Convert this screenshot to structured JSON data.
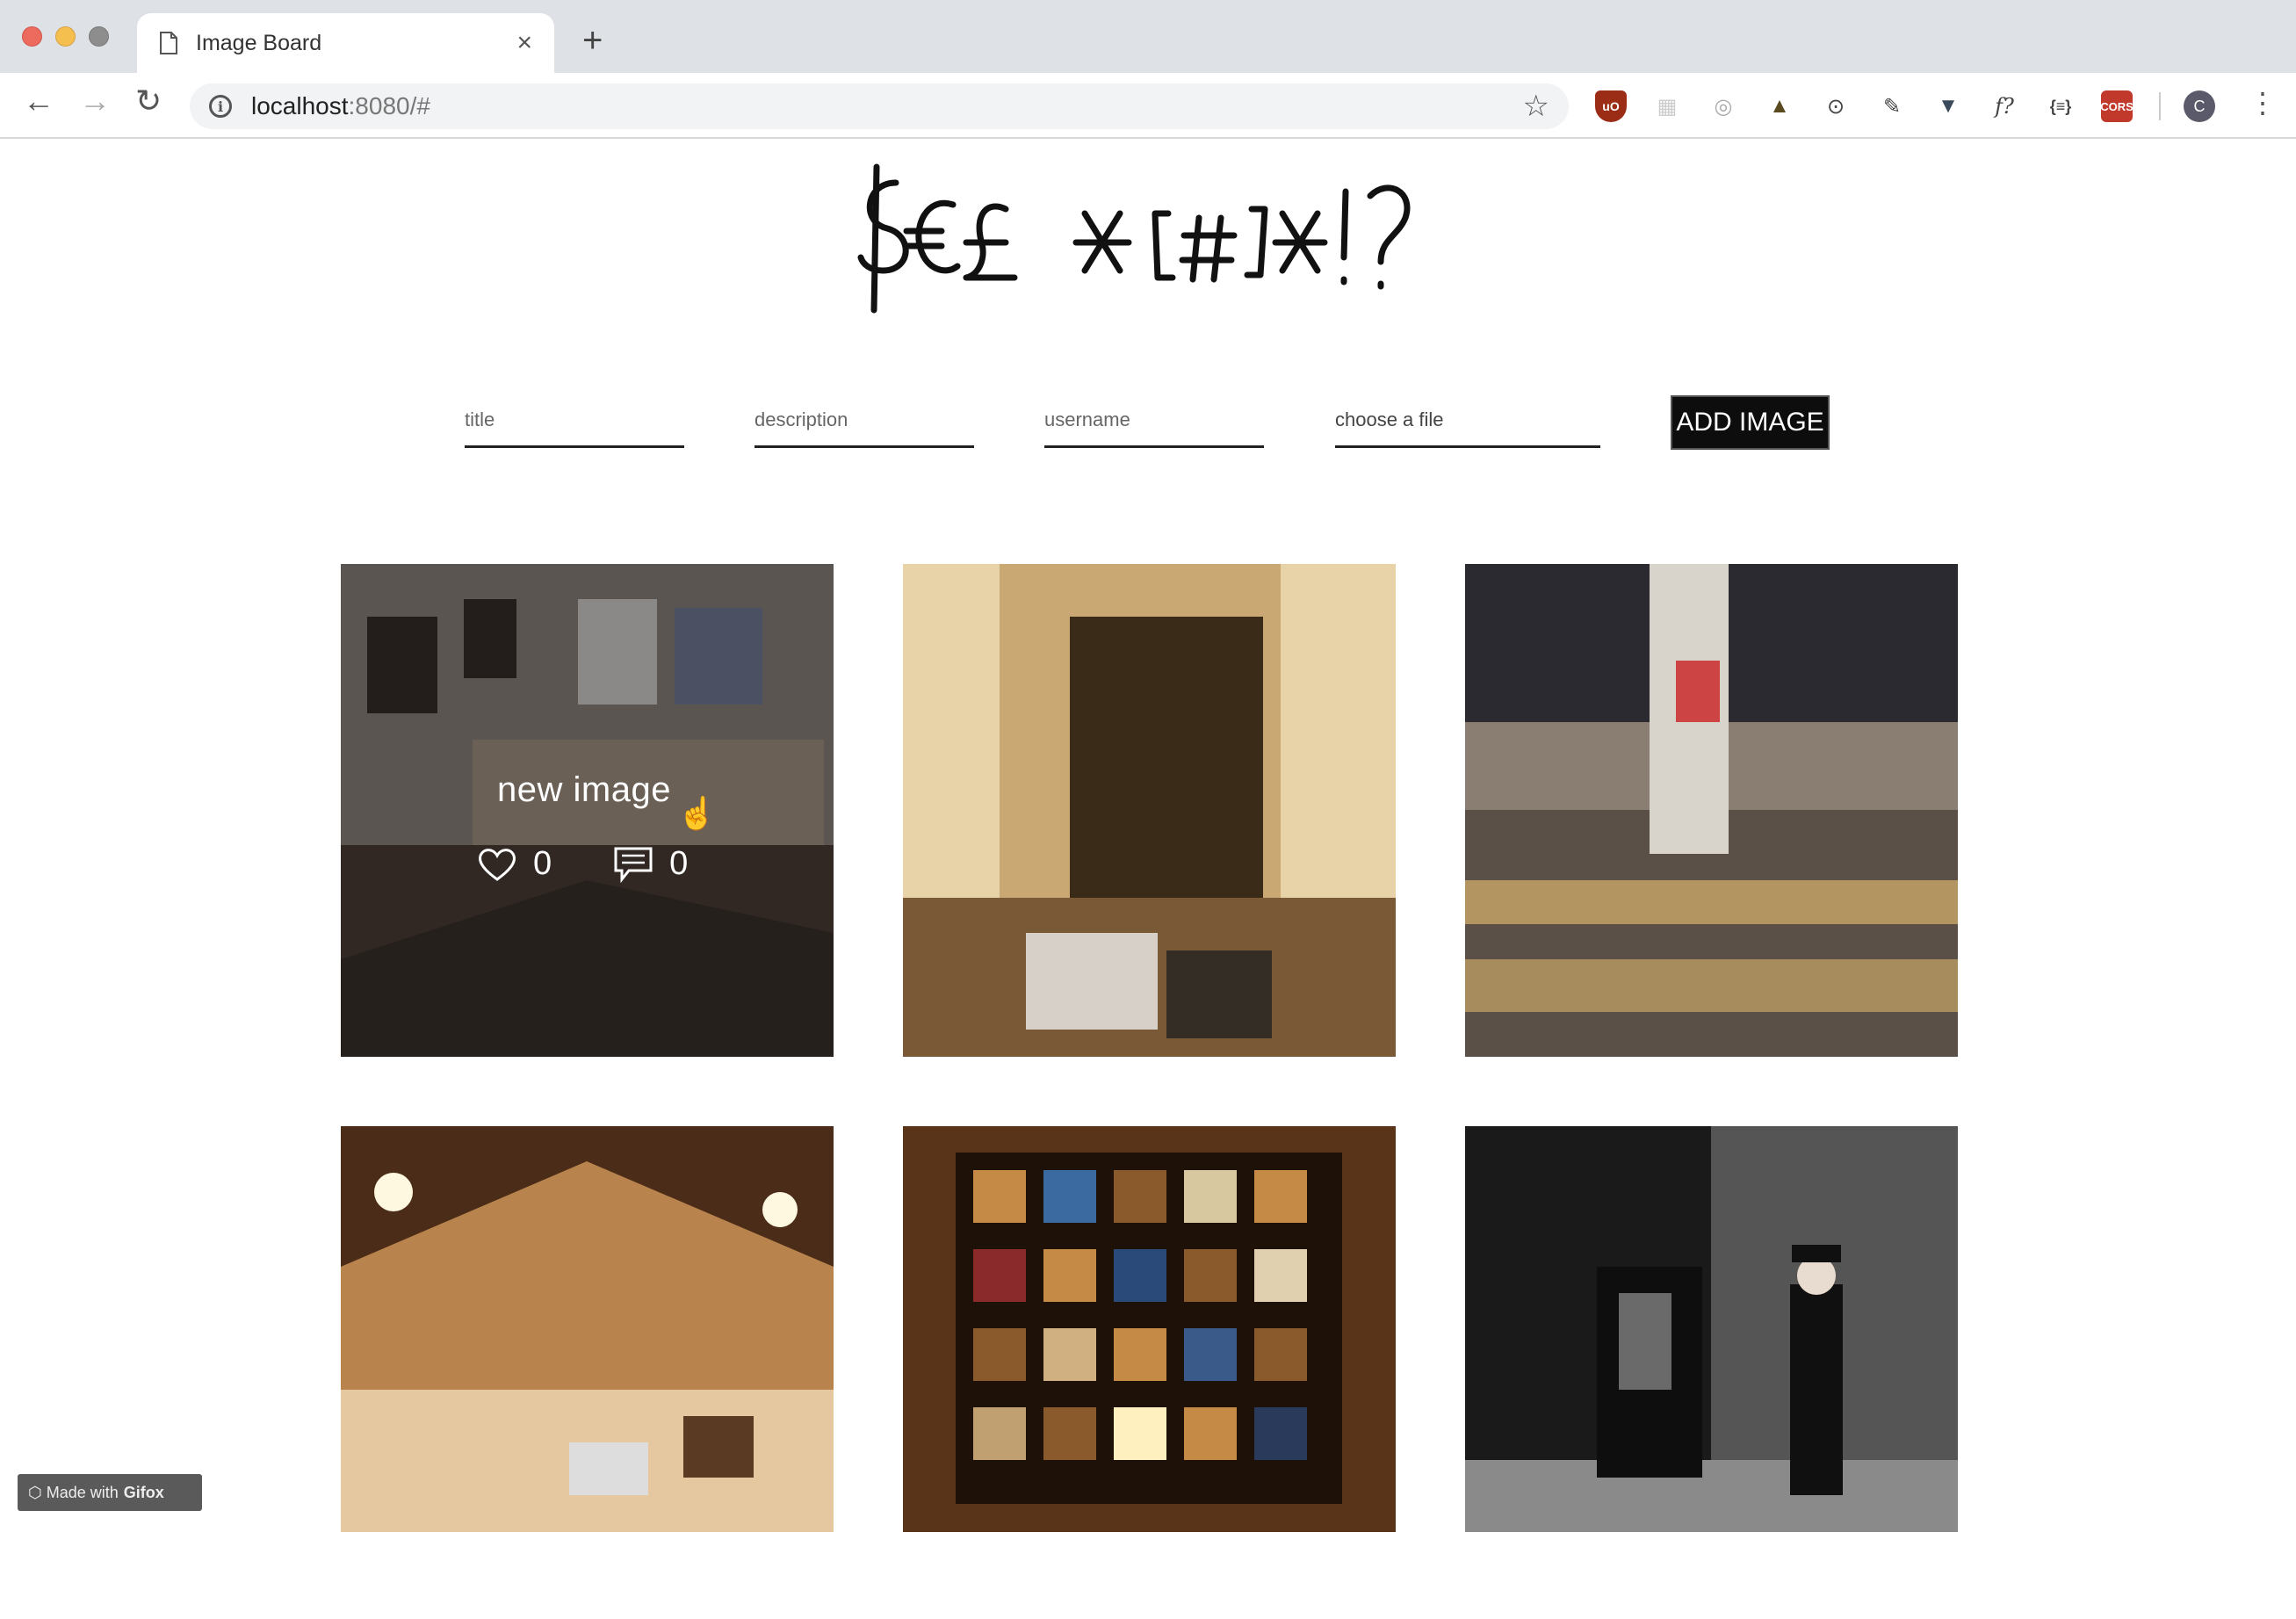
{
  "browser": {
    "tab_title": "Image Board",
    "url_host": "localhost",
    "url_rest": ":8080/#",
    "avatar_letter": "C",
    "ext_cors": "CORS",
    "ext_fx": "f?",
    "ext_json": "{≡}",
    "ext_ub": "uO"
  },
  "header": {
    "logo_text": "$€£ *[#]*!?"
  },
  "form": {
    "title_placeholder": "title",
    "description_placeholder": "description",
    "username_placeholder": "username",
    "file_label": "choose a file",
    "submit_label": "ADD IMAGE"
  },
  "cards": [
    {
      "title": "new image",
      "likes": "0",
      "comments": "0",
      "palette": [
        "#6a6460",
        "#3a302a",
        "#8a7a6a",
        "#2a2420"
      ]
    },
    {
      "palette": [
        "#c9a874",
        "#3a2a18",
        "#e8d3a8",
        "#7a5a36"
      ]
    },
    {
      "palette": [
        "#8a7e72",
        "#2a2a30",
        "#c8a668",
        "#5a5048"
      ]
    },
    {
      "palette": [
        "#b8834c",
        "#4a2c18",
        "#e6c8a0",
        "#7a4e2c"
      ]
    },
    {
      "palette": [
        "#5a3418",
        "#1e1208",
        "#c48a46",
        "#8a5a2c"
      ]
    },
    {
      "palette": [
        "#3e3e3e",
        "#1a1a1a",
        "#8a8a8a",
        "#555555"
      ]
    }
  ],
  "footer": {
    "gifox_prefix": "Made with",
    "gifox_brand": "Gifox"
  }
}
